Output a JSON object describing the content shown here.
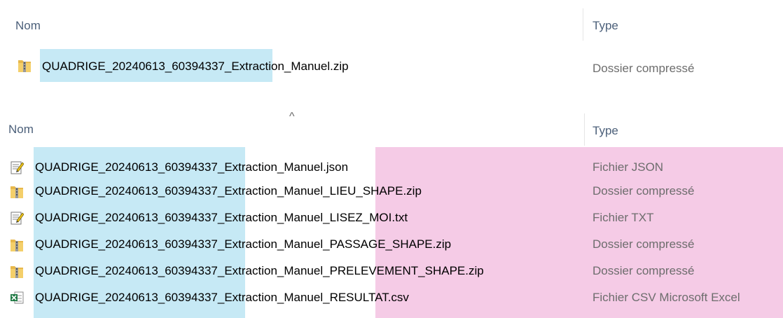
{
  "top": {
    "header": {
      "name": "Nom",
      "type": "Type"
    },
    "file": {
      "icon": "zip-folder-icon",
      "name": "QUADRIGE_20240613_60394337_Extraction_Manuel.zip",
      "type": "Dossier compressé"
    }
  },
  "bottom": {
    "header": {
      "name": "Nom",
      "type": "Type",
      "sort_indicator": "^"
    },
    "files": [
      {
        "icon": "json-file-icon",
        "name": "QUADRIGE_20240613_60394337_Extraction_Manuel.json",
        "type": "Fichier JSON"
      },
      {
        "icon": "zip-folder-icon",
        "name": "QUADRIGE_20240613_60394337_Extraction_Manuel_LIEU_SHAPE.zip",
        "type": "Dossier compressé"
      },
      {
        "icon": "text-file-icon",
        "name": "QUADRIGE_20240613_60394337_Extraction_Manuel_LISEZ_MOI.txt",
        "type": "Fichier TXT"
      },
      {
        "icon": "zip-folder-icon",
        "name": "QUADRIGE_20240613_60394337_Extraction_Manuel_PASSAGE_SHAPE.zip",
        "type": "Dossier compressé"
      },
      {
        "icon": "zip-folder-icon",
        "name": "QUADRIGE_20240613_60394337_Extraction_Manuel_PRELEVEMENT_SHAPE.zip",
        "type": "Dossier compressé"
      },
      {
        "icon": "excel-csv-icon",
        "name": "QUADRIGE_20240613_60394337_Extraction_Manuel_RESULTAT.csv",
        "type": "Fichier CSV Microsoft Excel"
      }
    ]
  },
  "colors": {
    "highlight_blue": "#c6e9f5",
    "highlight_pink": "#f5cbe6"
  }
}
